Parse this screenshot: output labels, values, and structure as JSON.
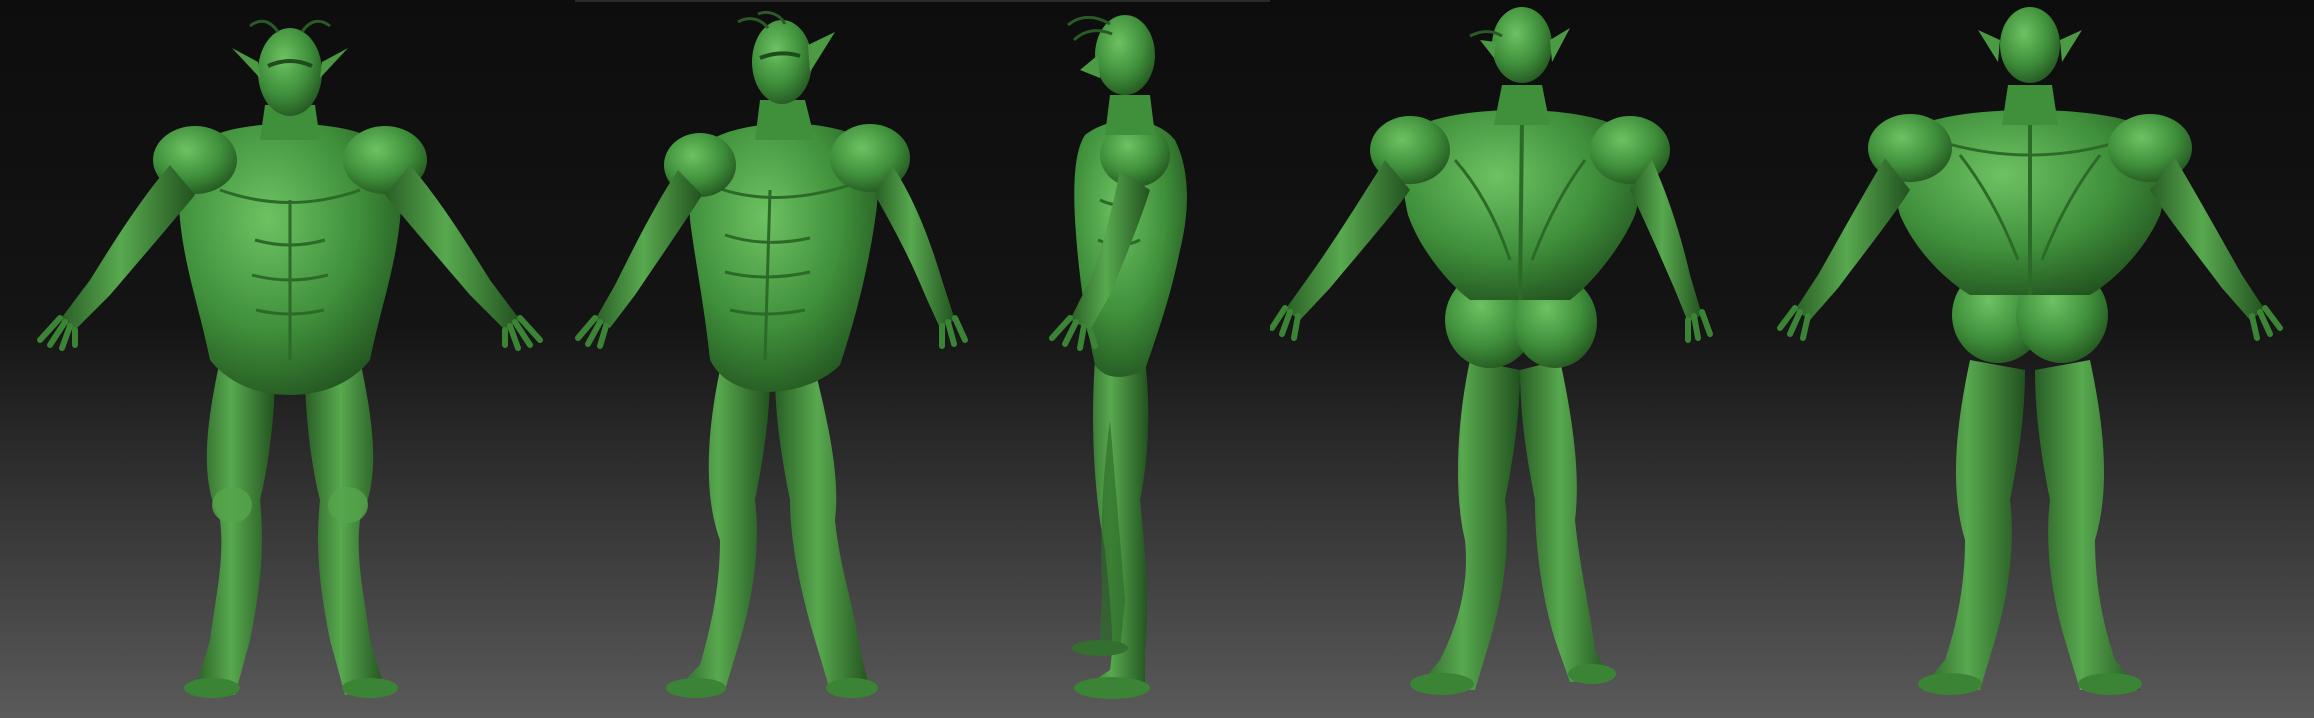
{
  "app": {
    "title": "",
    "description_none": ""
  },
  "colors": {
    "background_top": "#0e0e0e",
    "background_mid": "#1a1a1a",
    "background_bottom": "#5b5b5b",
    "model_base": "#3f8f3b",
    "model_light": "#6cc05f",
    "model_dark": "#1f4f1c",
    "model_rim": "#7ad26c"
  },
  "views": [
    {
      "id": "front",
      "icon": "front-view-model"
    },
    {
      "id": "three-quarter-front",
      "icon": "three-quarter-view-model"
    },
    {
      "id": "side",
      "icon": "side-view-model"
    },
    {
      "id": "three-quarter-back",
      "icon": "three-quarter-back-view-model"
    },
    {
      "id": "back",
      "icon": "back-view-model"
    }
  ]
}
